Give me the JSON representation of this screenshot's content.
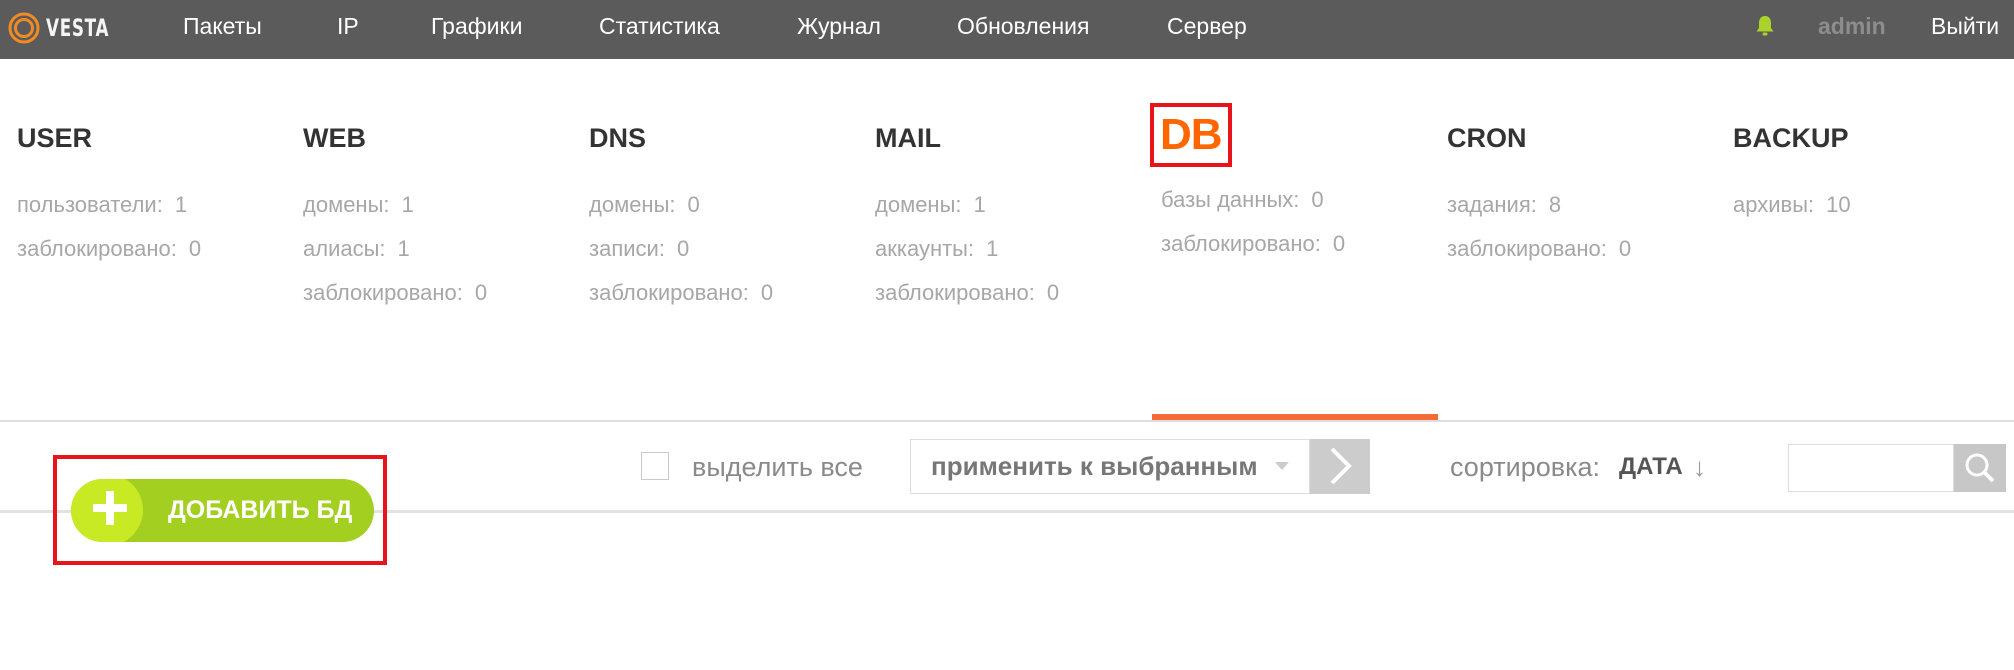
{
  "brand": {
    "logo_text": "VESTA"
  },
  "topnav": {
    "items": [
      "Пакеты",
      "IP",
      "Графики",
      "Статистика",
      "Журнал",
      "Обновления",
      "Сервер"
    ],
    "user": "admin",
    "logout": "Выйти"
  },
  "sections": [
    {
      "title": "USER",
      "stats": [
        {
          "label": "пользователи:",
          "value": "1"
        },
        {
          "label": "заблокировано:",
          "value": "0"
        }
      ]
    },
    {
      "title": "WEB",
      "stats": [
        {
          "label": "домены:",
          "value": "1"
        },
        {
          "label": "алиасы:",
          "value": "1"
        },
        {
          "label": "заблокировано:",
          "value": "0"
        }
      ]
    },
    {
      "title": "DNS",
      "stats": [
        {
          "label": "домены:",
          "value": "0"
        },
        {
          "label": "записи:",
          "value": "0"
        },
        {
          "label": "заблокировано:",
          "value": "0"
        }
      ]
    },
    {
      "title": "MAIL",
      "stats": [
        {
          "label": "домены:",
          "value": "1"
        },
        {
          "label": "аккаунты:",
          "value": "1"
        },
        {
          "label": "заблокировано:",
          "value": "0"
        }
      ]
    },
    {
      "title": "DB",
      "active": true,
      "stats": [
        {
          "label": "базы данных:",
          "value": "0"
        },
        {
          "label": "заблокировано:",
          "value": "0"
        }
      ]
    },
    {
      "title": "CRON",
      "stats": [
        {
          "label": "задания:",
          "value": "8"
        },
        {
          "label": "заблокировано:",
          "value": "0"
        }
      ]
    },
    {
      "title": "BACKUP",
      "stats": [
        {
          "label": "архивы:",
          "value": "10"
        }
      ]
    }
  ],
  "toolbar": {
    "add_label": "ДОБАВИТЬ БД",
    "select_all": "выделить все",
    "bulk_action": "применить к выбранным",
    "sort_label": "сортировка:",
    "sort_value": "ДАТА",
    "sort_dir": "↓"
  },
  "colors": {
    "topbar": "#5b5b5b",
    "active_section": "#ff6600",
    "add_button": "#a3cf21",
    "highlight_box": "#e8141a"
  }
}
